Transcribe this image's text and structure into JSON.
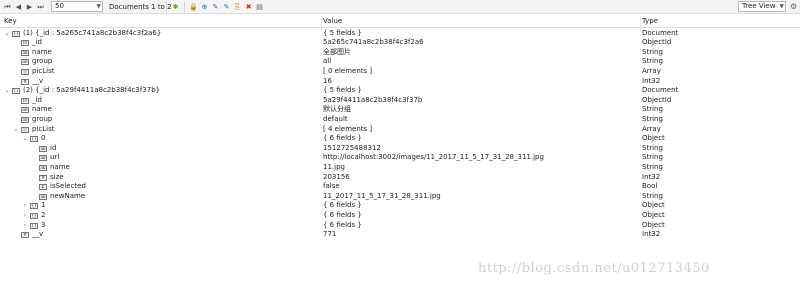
{
  "toolbar": {
    "first_icon": "first-page-icon",
    "prev_icon": "prev-page-icon",
    "next_icon": "next-page-icon",
    "last_icon": "last-page-icon",
    "page_size": "50",
    "doc_count": "Documents 1 to 2",
    "view_mode": "Tree View",
    "icons": [
      "refresh-icon",
      "lock-icon",
      "add-document-icon",
      "edit-document-icon",
      "edit-document-icon",
      "copy-document-icon",
      "delete-document-icon",
      "export-icon"
    ]
  },
  "columns": {
    "key": "Key",
    "value": "Value",
    "type": "Type"
  },
  "rows": [
    {
      "depth": 0,
      "toggle": "⌄",
      "icon": "document-icon",
      "key": "(1) {_id : 5a265c741a8c2b38f4c3f2a6}",
      "value": "{ 5 fields }",
      "type": "Document"
    },
    {
      "depth": 1,
      "toggle": "",
      "icon": "objectid-icon",
      "key": "_id",
      "value": "5a265c741a8c2b38f4c3f2a6",
      "type": "ObjectId"
    },
    {
      "depth": 1,
      "toggle": "",
      "icon": "string-icon",
      "key": "name",
      "value": "全部图片",
      "type": "String"
    },
    {
      "depth": 1,
      "toggle": "",
      "icon": "string-icon",
      "key": "group",
      "value": "all",
      "type": "String"
    },
    {
      "depth": 1,
      "toggle": "",
      "icon": "array-icon",
      "key": "picList",
      "value": "[ 0 elements ]",
      "type": "Array"
    },
    {
      "depth": 1,
      "toggle": "",
      "icon": "int32-icon",
      "key": "__v",
      "value": "16",
      "type": "Int32"
    },
    {
      "depth": 0,
      "toggle": "⌄",
      "icon": "document-icon",
      "key": "(2) {_id : 5a29f4411a8c2b38f4c3f37b}",
      "value": "{ 5 fields }",
      "type": "Document"
    },
    {
      "depth": 1,
      "toggle": "",
      "icon": "objectid-icon",
      "key": "_id",
      "value": "5a29f4411a8c2b38f4c3f37b",
      "type": "ObjectId"
    },
    {
      "depth": 1,
      "toggle": "",
      "icon": "string-icon",
      "key": "name",
      "value": "默认分组",
      "type": "String"
    },
    {
      "depth": 1,
      "toggle": "",
      "icon": "string-icon",
      "key": "group",
      "value": "default",
      "type": "String"
    },
    {
      "depth": 1,
      "toggle": "⌄",
      "icon": "array-icon",
      "key": "picList",
      "value": "[ 4 elements ]",
      "type": "Array"
    },
    {
      "depth": 2,
      "toggle": "⌄",
      "icon": "object-icon",
      "key": "0",
      "value": "{ 6 fields }",
      "type": "Object"
    },
    {
      "depth": 3,
      "toggle": "",
      "icon": "string-icon",
      "key": "id",
      "value": "1512725488312",
      "type": "String"
    },
    {
      "depth": 3,
      "toggle": "",
      "icon": "string-icon",
      "key": "url",
      "value": "http://localhost:3002/images/11_2017_11_5_17_31_28_311.jpg",
      "type": "String"
    },
    {
      "depth": 3,
      "toggle": "",
      "icon": "string-icon",
      "key": "name",
      "value": "11.jpg",
      "type": "String"
    },
    {
      "depth": 3,
      "toggle": "",
      "icon": "int32-icon",
      "key": "size",
      "value": "203156",
      "type": "Int32"
    },
    {
      "depth": 3,
      "toggle": "",
      "icon": "bool-icon",
      "key": "isSelected",
      "value": "false",
      "type": "Bool"
    },
    {
      "depth": 3,
      "toggle": "",
      "icon": "string-icon",
      "key": "newName",
      "value": "11_2017_11_5_17_31_28_311.jpg",
      "type": "String"
    },
    {
      "depth": 2,
      "toggle": "›",
      "icon": "object-icon",
      "key": "1",
      "value": "{ 6 fields }",
      "type": "Object"
    },
    {
      "depth": 2,
      "toggle": "›",
      "icon": "object-icon",
      "key": "2",
      "value": "{ 6 fields }",
      "type": "Object"
    },
    {
      "depth": 2,
      "toggle": "›",
      "icon": "object-icon",
      "key": "3",
      "value": "{ 6 fields }",
      "type": "Object"
    },
    {
      "depth": 1,
      "toggle": "",
      "icon": "int32-icon",
      "key": "__v",
      "value": "771",
      "type": "Int32"
    }
  ],
  "watermark": "http://blog.csdn.net/u012713450"
}
